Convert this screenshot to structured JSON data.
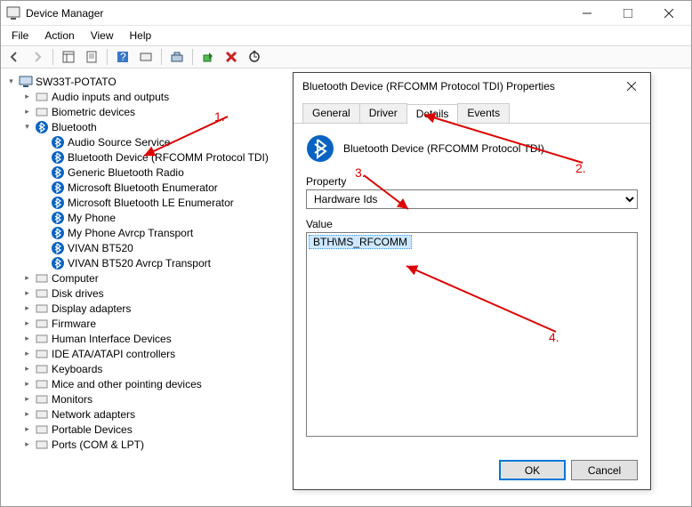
{
  "window": {
    "title": "Device Manager"
  },
  "menu": {
    "file": "File",
    "action": "Action",
    "view": "View",
    "help": "Help"
  },
  "tree": {
    "root": "SW33T-POTATO",
    "items": [
      "Audio inputs and outputs",
      "Biometric devices",
      "Bluetooth",
      "Computer",
      "Disk drives",
      "Display adapters",
      "Firmware",
      "Human Interface Devices",
      "IDE ATA/ATAPI controllers",
      "Keyboards",
      "Mice and other pointing devices",
      "Monitors",
      "Network adapters",
      "Portable Devices",
      "Ports (COM & LPT)"
    ],
    "bt_children": [
      "Audio Source Service",
      "Bluetooth Device (RFCOMM Protocol TDI)",
      "Generic Bluetooth Radio",
      "Microsoft Bluetooth Enumerator",
      "Microsoft Bluetooth LE Enumerator",
      "My Phone",
      "My Phone Avrcp Transport",
      "VIVAN BT520",
      "VIVAN BT520 Avrcp Transport"
    ]
  },
  "dialog": {
    "title": "Bluetooth Device (RFCOMM Protocol TDI) Properties",
    "tabs": {
      "general": "General",
      "driver": "Driver",
      "details": "Details",
      "events": "Events"
    },
    "device_name": "Bluetooth Device (RFCOMM Protocol TDI)",
    "property_label": "Property",
    "property_value": "Hardware Ids",
    "value_label": "Value",
    "value_item": "BTH\\MS_RFCOMM",
    "ok": "OK",
    "cancel": "Cancel"
  },
  "annotations": {
    "a1": "1.",
    "a2": "2.",
    "a3": "3.",
    "a4": "4."
  }
}
